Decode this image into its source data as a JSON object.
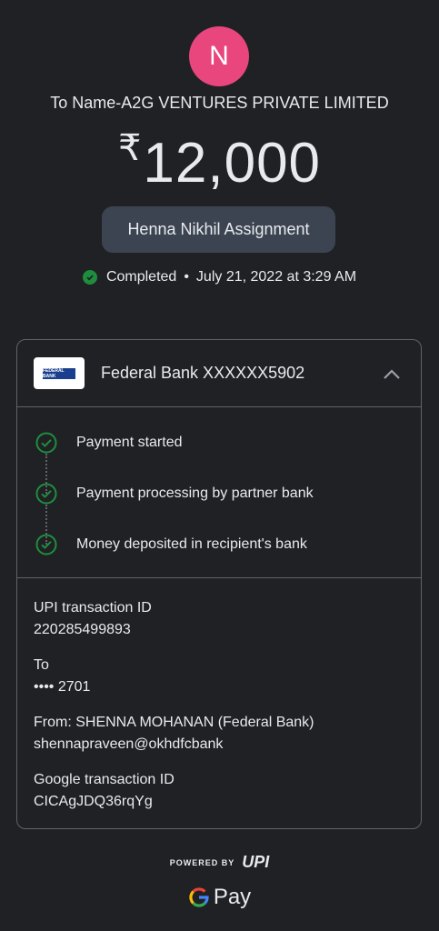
{
  "avatar": {
    "initial": "N",
    "color": "#e8467c"
  },
  "recipient": "To Name-A2G VENTURES PRIVATE LIMITED",
  "amount": {
    "currency": "₹",
    "value": "12,000"
  },
  "note": "Henna Nikhil Assignment",
  "status": {
    "state": "Completed",
    "separator": "•",
    "datetime": "July 21, 2022 at 3:29 AM",
    "color": "#1e8e3e"
  },
  "bank": {
    "logo_text": "FEDERAL BANK",
    "name": "Federal Bank XXXXXX5902",
    "toggle_icon": "chevron-up-icon"
  },
  "steps": [
    {
      "label": "Payment started",
      "icon": "check-circle-icon"
    },
    {
      "label": "Payment processing by partner bank",
      "icon": "check-circle-icon"
    },
    {
      "label": "Money deposited in recipient's bank",
      "icon": "check-circle-icon"
    }
  ],
  "details": [
    {
      "key": "UPI transaction ID",
      "value": "220285499893"
    },
    {
      "key": "To",
      "value": "•••• 2701"
    },
    {
      "key": "From: SHENNA MOHANAN (Federal Bank)",
      "value": "shennapraveen@okhdfcbank"
    },
    {
      "key": "Google transaction ID",
      "value": "CICAgJDQ36rqYg"
    }
  ],
  "footer": {
    "powered_by": "POWERED BY",
    "upi_logo": "UPI",
    "gpay_g": "G",
    "gpay_text": "Pay"
  }
}
